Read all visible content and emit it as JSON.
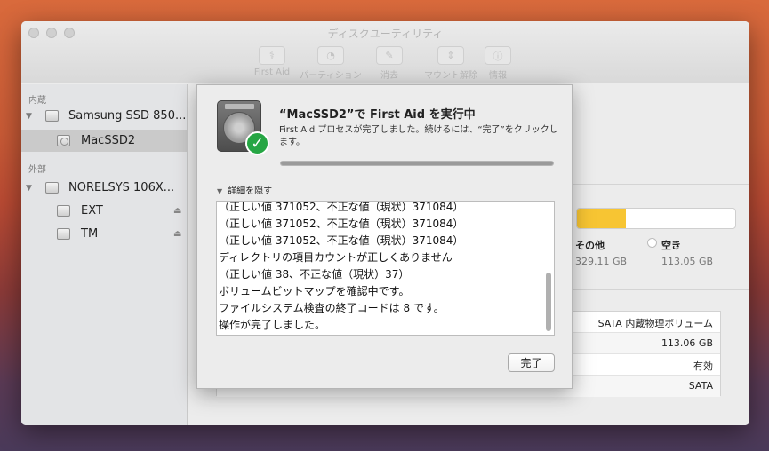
{
  "window": {
    "title": "ディスクユーティリティ"
  },
  "toolbar": {
    "items": [
      {
        "label": "First Aid",
        "icon": "stethoscope-icon",
        "glyph": "⚕"
      },
      {
        "label": "パーティション",
        "icon": "partition-icon",
        "glyph": "◔"
      },
      {
        "label": "消去",
        "icon": "erase-icon",
        "glyph": "✎"
      },
      {
        "label": "マウント解除",
        "icon": "unmount-icon",
        "glyph": "⇕"
      },
      {
        "label": "情報",
        "icon": "info-icon",
        "glyph": "ⓘ"
      }
    ]
  },
  "sidebar": {
    "internal_header": "内蔵",
    "external_header": "外部",
    "internal_disk": "Samsung SSD 850...",
    "internal_volume": "MacSSD2",
    "external_disk": "NORELSYS 106X...",
    "external_volumes": [
      "EXT",
      "TM"
    ],
    "eject_glyph": "⏏"
  },
  "usage": {
    "other_label": "その他",
    "other_value": "329.11 GB",
    "free_label": "空き",
    "free_value": "113.05 GB",
    "used_fraction": 0.31,
    "other_color": "#f7c533"
  },
  "info_table": {
    "rows": [
      "SATA 内蔵物理ボリューム",
      "113.06 GB",
      "有効",
      "SATA"
    ]
  },
  "dialog": {
    "title": "“MacSSD2”で First Aid を実行中",
    "message": "First Aid プロセスが完了しました。続けるには、“完了”をクリックします。",
    "progress_fraction": 1.0,
    "details_toggle": "詳細を隠す",
    "log": [
      "（正しい値 371052、不正な値（現状）371084）",
      "（正しい値 371052、不正な値（現状）371084）",
      "（正しい値 371052、不正な値（現状）371084）",
      "ディレクトリの項目カウントが正しくありません",
      "（正しい値 38、不正な値（現状）37）",
      "ボリュームビットマップを確認中です。",
      "ファイルシステム検査の終了コードは 8 です。",
      "操作が完了しました。"
    ],
    "done_label": "完了",
    "check_glyph": "✓"
  }
}
